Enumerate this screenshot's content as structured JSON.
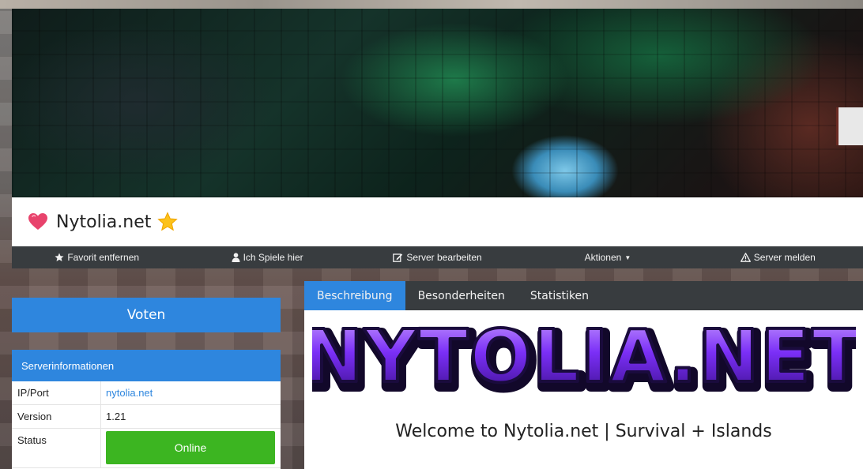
{
  "server": {
    "name": "Nytolia.net",
    "heart_icon": "heart-icon",
    "star_icon": "star-icon"
  },
  "actions": [
    {
      "label": "Favorit entfernen",
      "icon": "star-icon"
    },
    {
      "label": "Ich Spiele hier",
      "icon": "user-icon"
    },
    {
      "label": "Server bearbeiten",
      "icon": "edit-icon"
    },
    {
      "label": "Aktionen",
      "icon": "caret-down-icon"
    },
    {
      "label": "Server melden",
      "icon": "warning-icon"
    }
  ],
  "sidebar": {
    "vote_label": "Voten",
    "info_title": "Serverinformationen",
    "rows": [
      {
        "key": "IP/Port",
        "value": "nytolia.net"
      },
      {
        "key": "Version",
        "value": "1.21"
      },
      {
        "key": "Status",
        "value": "Online"
      }
    ]
  },
  "tabs": [
    {
      "label": "Beschreibung",
      "active": true
    },
    {
      "label": "Besonderheiten",
      "active": false
    },
    {
      "label": "Statistiken",
      "active": false
    }
  ],
  "description": {
    "logo_text": "NYTOLIA.NET",
    "welcome": "Welcome to Nytolia.net | Survival + Islands"
  },
  "colors": {
    "accent": "#2e86de",
    "dark_bar": "#383c3f",
    "online": "#3cb521",
    "logo_purple": "#7b2ff7"
  }
}
